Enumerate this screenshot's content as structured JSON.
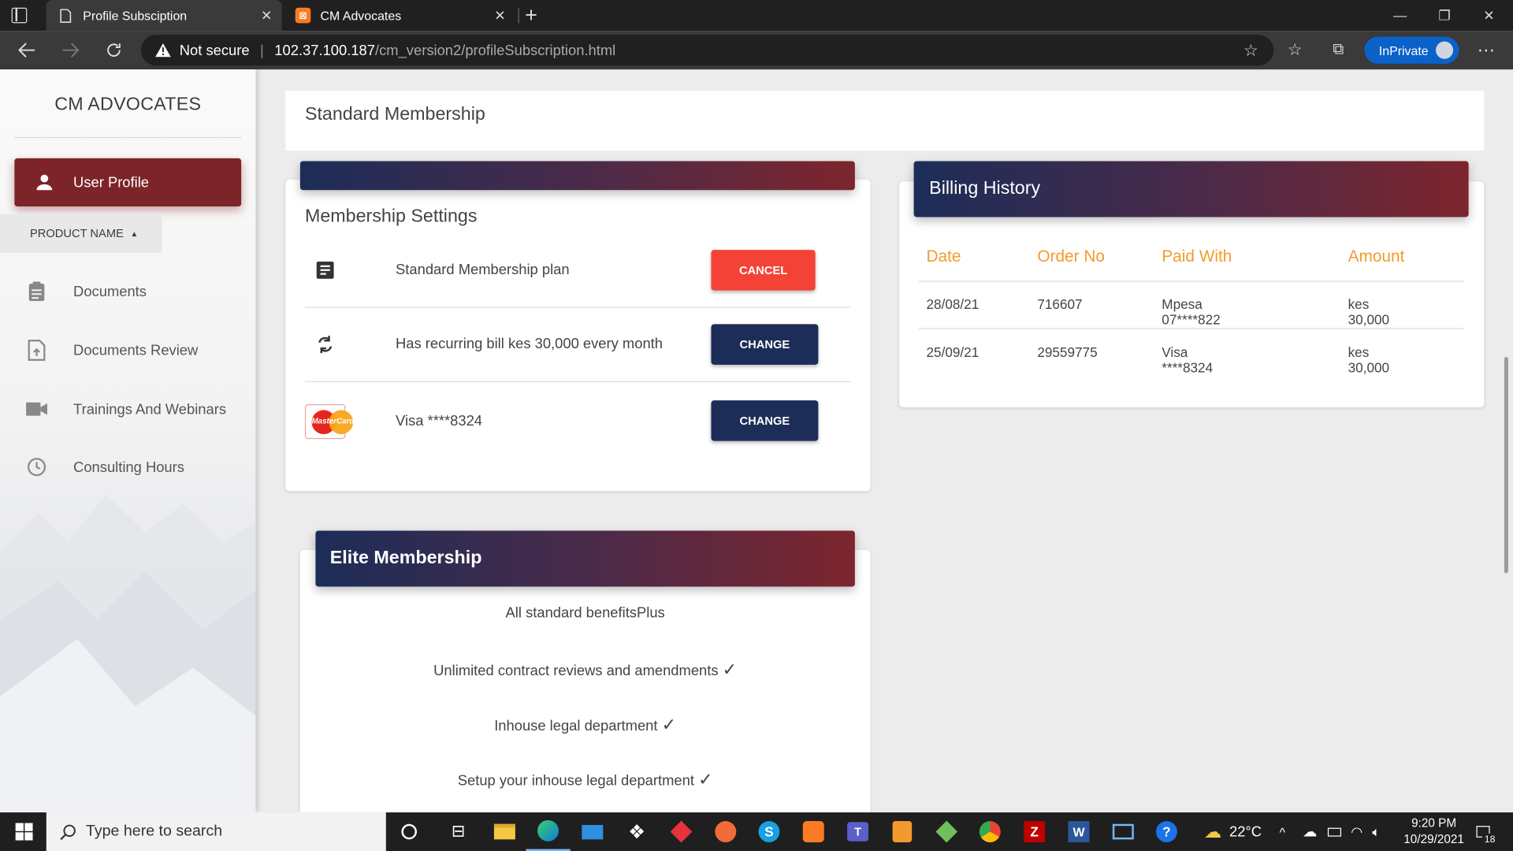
{
  "browser": {
    "tabs": [
      {
        "title": "Profile Subsciption",
        "active": true
      },
      {
        "title": "CM Advocates",
        "active": false
      }
    ],
    "security_label": "Not secure",
    "url_host": "102.37.100.187",
    "url_path": "/cm_version2/profileSubscription.html",
    "inprivate_label": "InPrivate"
  },
  "sidebar": {
    "brand": "CM ADVOCATES",
    "active_item": "User Profile",
    "product_name": "PRODUCT NAME",
    "items": [
      {
        "label": "Documents",
        "icon": "clipboard-icon"
      },
      {
        "label": "Documents Review",
        "icon": "file-upload-icon"
      },
      {
        "label": "Trainings And Webinars",
        "icon": "videocam-icon"
      },
      {
        "label": "Consulting Hours",
        "icon": "clock-icon"
      }
    ]
  },
  "header": {
    "title": "Standard Membership"
  },
  "membership_settings": {
    "title": "Membership Settings",
    "rows": [
      {
        "text": "Standard Membership plan",
        "button": "CANCEL",
        "icon": "document-icon"
      },
      {
        "text": "Has recurring bill kes 30,000 every month",
        "button": "CHANGE",
        "icon": "recurring-icon"
      },
      {
        "text": "Visa ****8324",
        "button": "CHANGE",
        "icon": "mastercard-icon"
      }
    ],
    "mastercard_text": "MasterCard"
  },
  "billing": {
    "title": "Billing History",
    "columns": [
      "Date",
      "Order No",
      "Paid With",
      "Amount"
    ],
    "rows": [
      [
        "28/08/21",
        "716607",
        "Mpesa 07****822",
        "kes 30,000"
      ],
      [
        "25/09/21",
        "29559775",
        "Visa ****8324",
        "kes 30,000"
      ]
    ]
  },
  "elite": {
    "title": "Elite Membership",
    "lines": [
      "All standard benefitsPlus",
      "Unlimited contract reviews and amendments",
      "Inhouse legal department",
      "Setup your inhouse legal department"
    ]
  },
  "taskbar": {
    "search_placeholder": "Type here to search",
    "weather": "22°C",
    "time": "9:20 PM",
    "date": "10/29/2021",
    "notifications": "18"
  },
  "colors": {
    "brand_red": "#7c2429",
    "navy": "#1c2d58",
    "cancel_red": "#f44336",
    "accent_orange": "#f39a2e",
    "edge_blue": "#0a62c9"
  }
}
